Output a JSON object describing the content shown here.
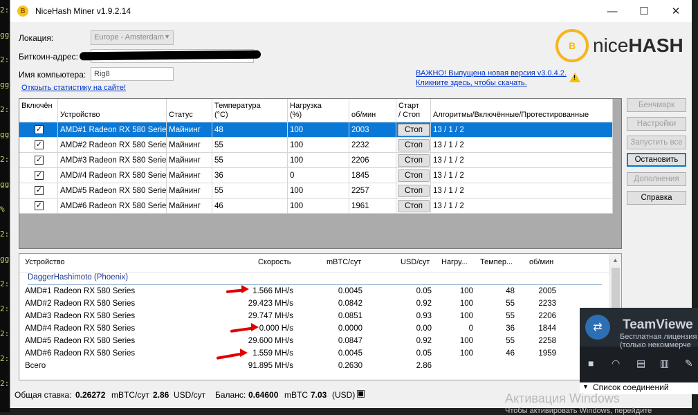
{
  "window": {
    "title": "NiceHash Miner v1.9.2.14",
    "minimize": "—",
    "maximize": "☐",
    "close": "✕"
  },
  "form": {
    "location_label": "Локация:",
    "location_value": "Europe - Amsterdam",
    "bitcoin_label": "Биткоин-адрес:",
    "computer_label": "Имя компьютера:",
    "computer_value": "Rig8",
    "stats_link": "Открыть статистику на сайте!"
  },
  "logo": {
    "coin": "B",
    "text_plain": "nice",
    "text_bold": "HASH"
  },
  "update": {
    "line1": "ВАЖНО! Выпущена новая версия v3.0.4.2.",
    "line2": "Кликните здесь, чтобы скачать."
  },
  "devices_table": {
    "headers": {
      "enabled": "Включён",
      "device": "Устройство",
      "status": "Статус",
      "temp1": "Температура",
      "temp2": "(°C)",
      "load1": "Нагрузка",
      "load2": "(%)",
      "rpm": "об/мин",
      "startstop1": "Старт",
      "startstop2": "/ Стоп",
      "algos": "Алгоритмы/Включённые/Протестированные"
    },
    "rows": [
      {
        "device": "AMD#1 Radeon RX 580 Series",
        "status": "Майнинг",
        "temp": "48",
        "load": "100",
        "rpm": "2003",
        "btn": "Стоп",
        "algos": "13 / 1 / 2",
        "check": "✓"
      },
      {
        "device": "AMD#2 Radeon RX 580 Series",
        "status": "Майнинг",
        "temp": "55",
        "load": "100",
        "rpm": "2232",
        "btn": "Стоп",
        "algos": "13 / 1 / 2",
        "check": "✓"
      },
      {
        "device": "AMD#3 Radeon RX 580 Series",
        "status": "Майнинг",
        "temp": "55",
        "load": "100",
        "rpm": "2206",
        "btn": "Стоп",
        "algos": "13 / 1 / 2",
        "check": "✓"
      },
      {
        "device": "AMD#4 Radeon RX 580 Series",
        "status": "Майнинг",
        "temp": "36",
        "load": "0",
        "rpm": "1845",
        "btn": "Стоп",
        "algos": "13 / 1 / 2",
        "check": "✓"
      },
      {
        "device": "AMD#5 Radeon RX 580 Series",
        "status": "Майнинг",
        "temp": "55",
        "load": "100",
        "rpm": "2257",
        "btn": "Стоп",
        "algos": "13 / 1 / 2",
        "check": "✓"
      },
      {
        "device": "AMD#6 Radeon RX 580 Series",
        "status": "Майнинг",
        "temp": "46",
        "load": "100",
        "rpm": "1961",
        "btn": "Стоп",
        "algos": "13 / 1 / 2",
        "check": "✓"
      }
    ]
  },
  "side_buttons": {
    "benchmark": "Бенчмарк",
    "settings": "Настройки",
    "start_all": "Запустить все",
    "stop": "Остановить",
    "addons": "Дополнения",
    "help": "Справка"
  },
  "mining_table": {
    "headers": {
      "device": "Устройство",
      "speed": "Скорость",
      "mbtc": "mBTC/сут",
      "usd": "USD/сут",
      "load": "Нагру...",
      "temp": "Темпер...",
      "rpm": "об/мин"
    },
    "group": "DaggerHashimoto (Phoenix)",
    "rows": [
      {
        "device": "AMD#1 Radeon RX 580 Series",
        "speed": "1.566 MH/s",
        "mbtc": "0.0045",
        "usd": "0.05",
        "load": "100",
        "temp": "48",
        "rpm": "2005"
      },
      {
        "device": "AMD#2 Radeon RX 580 Series",
        "speed": "29.423 MH/s",
        "mbtc": "0.0842",
        "usd": "0.92",
        "load": "100",
        "temp": "55",
        "rpm": "2233"
      },
      {
        "device": "AMD#3 Radeon RX 580 Series",
        "speed": "29.747 MH/s",
        "mbtc": "0.0851",
        "usd": "0.93",
        "load": "100",
        "temp": "55",
        "rpm": "2206"
      },
      {
        "device": "AMD#4 Radeon RX 580 Series",
        "speed": "0.000 H/s",
        "mbtc": "0.0000",
        "usd": "0.00",
        "load": "0",
        "temp": "36",
        "rpm": "1844"
      },
      {
        "device": "AMD#5 Radeon RX 580 Series",
        "speed": "29.600 MH/s",
        "mbtc": "0.0847",
        "usd": "0.92",
        "load": "100",
        "temp": "55",
        "rpm": "2258"
      },
      {
        "device": "AMD#6 Radeon RX 580 Series",
        "speed": "1.559 MH/s",
        "mbtc": "0.0045",
        "usd": "0.05",
        "load": "100",
        "temp": "46",
        "rpm": "1959"
      }
    ],
    "total": {
      "label": "Всего",
      "speed": "91.895 MH/s",
      "mbtc": "0.2630",
      "usd": "2.86"
    }
  },
  "status_bar": {
    "rate_label": "Общая ставка:",
    "rate_value": "0.26272",
    "rate_unit": "mBTC/сут",
    "rate_usd": "2.86",
    "rate_usd_unit": "USD/сут",
    "balance_label": "Баланс:",
    "balance_value": "0.64600",
    "balance_unit": "mBTC",
    "balance_usd": "7.03",
    "balance_usd_unit": "(USD)"
  },
  "teamviewer": {
    "name": "TeamViewe",
    "sub1": "Бесплатная лицензия",
    "sub2": "(только некоммерче",
    "connections": "Список соединений"
  },
  "watermark": {
    "activation": "Активация Windows",
    "hint": "Чтобы активировать Windows, перейдите"
  },
  "terminal_lines": [
    "2:",
    "gge",
    "2:",
    "gge",
    "2:",
    "gge",
    "2:",
    "gge",
    "%",
    "2:",
    "gge",
    "2:",
    "2:",
    "2:",
    "2:",
    "2:"
  ],
  "colors": {
    "selection": "#0a78d7",
    "link": "#0033cc",
    "arrow": "#e00000",
    "logo_coin": "#f7b51b",
    "group_text": "#1e3a8a"
  }
}
